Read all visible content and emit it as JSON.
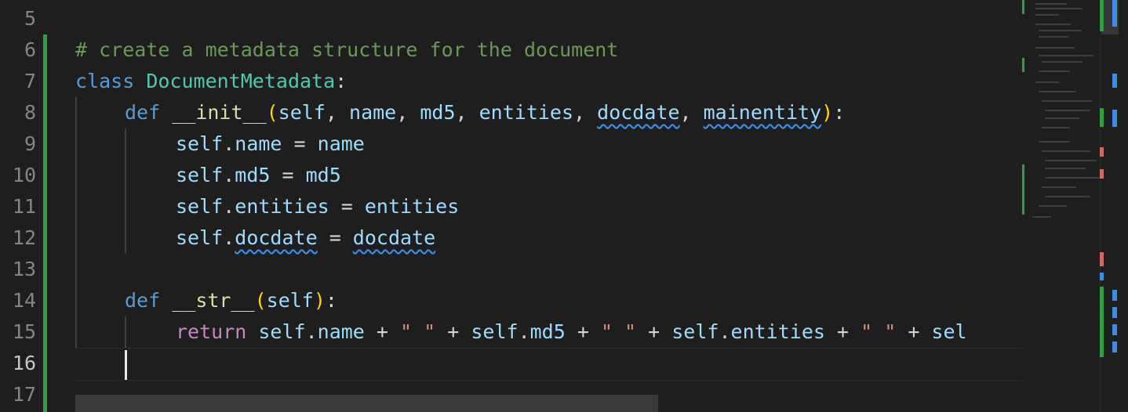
{
  "editor": {
    "language": "python",
    "active_line": "16",
    "line_numbers": [
      "5",
      "6",
      "7",
      "8",
      "9",
      "10",
      "11",
      "12",
      "13",
      "14",
      "15",
      "16",
      "17"
    ],
    "lines": {
      "l6": {
        "comment": "# create a metadata structure for the document"
      },
      "l7": {
        "kw": "class",
        "class_name": "DocumentMetadata",
        "colon": ":"
      },
      "l8": {
        "kw": "def",
        "fn": "__init__",
        "open": "(",
        "p_self": "self",
        "p_name": "name",
        "p_md5": "md5",
        "p_entities": "entities",
        "p_docdate": "docdate",
        "p_mainentity": "mainentity",
        "sep": ", ",
        "close": ")",
        "colon": ":"
      },
      "l9": {
        "obj": "self",
        "dot": ".",
        "attr": "name",
        "eq": " = ",
        "val": "name"
      },
      "l10": {
        "obj": "self",
        "dot": ".",
        "attr": "md5",
        "eq": " = ",
        "val": "md5"
      },
      "l11": {
        "obj": "self",
        "dot": ".",
        "attr": "entities",
        "eq": " = ",
        "val": "entities"
      },
      "l12": {
        "obj": "self",
        "dot": ".",
        "attr": "docdate",
        "eq": " = ",
        "val": "docdate"
      },
      "l14": {
        "kw": "def",
        "fn": "__str__",
        "open": "(",
        "p_self": "self",
        "close": ")",
        "colon": ":"
      },
      "l15": {
        "kw": "return",
        "a_obj": "self",
        "a_attr": "name",
        "b_obj": "self",
        "b_attr": "md5",
        "c_obj": "self",
        "c_attr": "entities",
        "d_obj": "sel",
        "dot": ".",
        "plus": " + ",
        "space_str": "\" \""
      }
    }
  },
  "theme": {
    "background": "#1e1e1e",
    "git_added": "#2ea043",
    "warning_squiggle": "#3794ff",
    "keyword": "#569cd6",
    "control_keyword": "#c586c0",
    "class_name": "#4ec9b0",
    "function": "#dcdcaa",
    "variable": "#9cdcfe",
    "string": "#ce9178",
    "comment": "#6a9955"
  },
  "icons": {
    "cursor": "text-cursor-icon",
    "squiggle": "warning-squiggle-icon"
  }
}
